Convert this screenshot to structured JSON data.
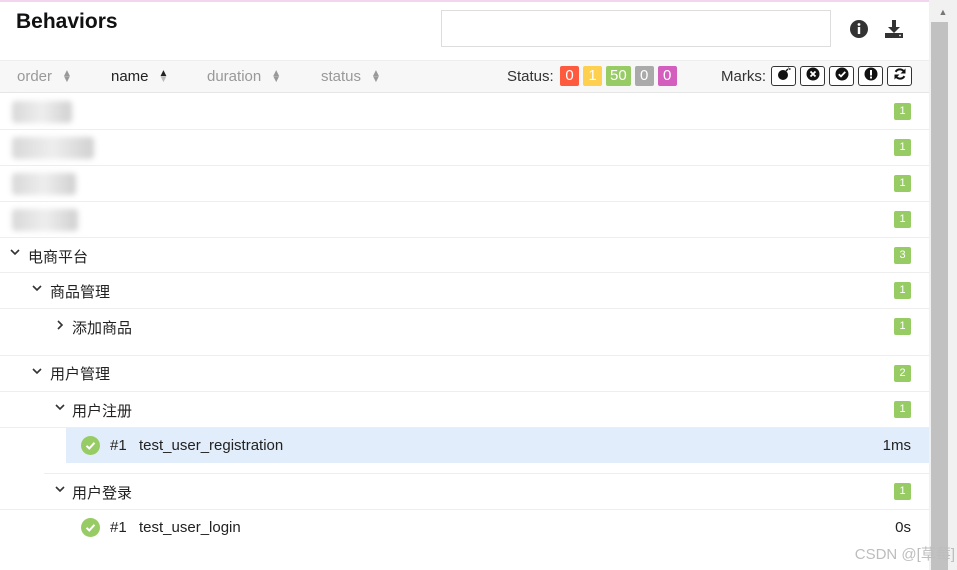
{
  "header": {
    "title": "Behaviors",
    "search_value": "",
    "info_icon": "info-circle-icon",
    "download_icon": "download-icon"
  },
  "sort_columns": [
    {
      "label": "order",
      "active": false
    },
    {
      "label": "name",
      "active": true
    },
    {
      "label": "duration",
      "active": false
    },
    {
      "label": "status",
      "active": false
    }
  ],
  "status": {
    "label": "Status:",
    "badges": [
      {
        "value": "0",
        "type": "failed",
        "color": "#fd5a3e"
      },
      {
        "value": "1",
        "type": "broken",
        "color": "#ffd050"
      },
      {
        "value": "50",
        "type": "passed",
        "color": "#97cc64"
      },
      {
        "value": "0",
        "type": "skipped",
        "color": "#aaaaaa"
      },
      {
        "value": "0",
        "type": "unknown",
        "color": "#d35ebe"
      }
    ]
  },
  "marks": {
    "label": "Marks:",
    "items": [
      "bomb-icon",
      "times-circle-icon",
      "check-circle-icon",
      "exclamation-circle-icon",
      "refresh-icon"
    ]
  },
  "tree": {
    "blurred_rows": [
      {
        "count": "1"
      },
      {
        "count": "1"
      },
      {
        "count": "1"
      },
      {
        "count": "1"
      }
    ],
    "group_ecommerce": {
      "label": "电商平台",
      "count": "3"
    },
    "group_product_mgmt": {
      "label": "商品管理",
      "count": "1"
    },
    "group_add_product": {
      "label": "添加商品",
      "count": "1"
    },
    "group_user_mgmt": {
      "label": "用户管理",
      "count": "2"
    },
    "group_user_register": {
      "label": "用户注册",
      "count": "1"
    },
    "case_registration": {
      "number": "#1",
      "name": "test_user_registration",
      "duration": "1ms"
    },
    "group_user_login": {
      "label": "用户登录",
      "count": "1"
    },
    "case_login": {
      "number": "#1",
      "name": "test_user_login",
      "duration": "0s"
    }
  },
  "watermark": "CSDN @[草莓]"
}
